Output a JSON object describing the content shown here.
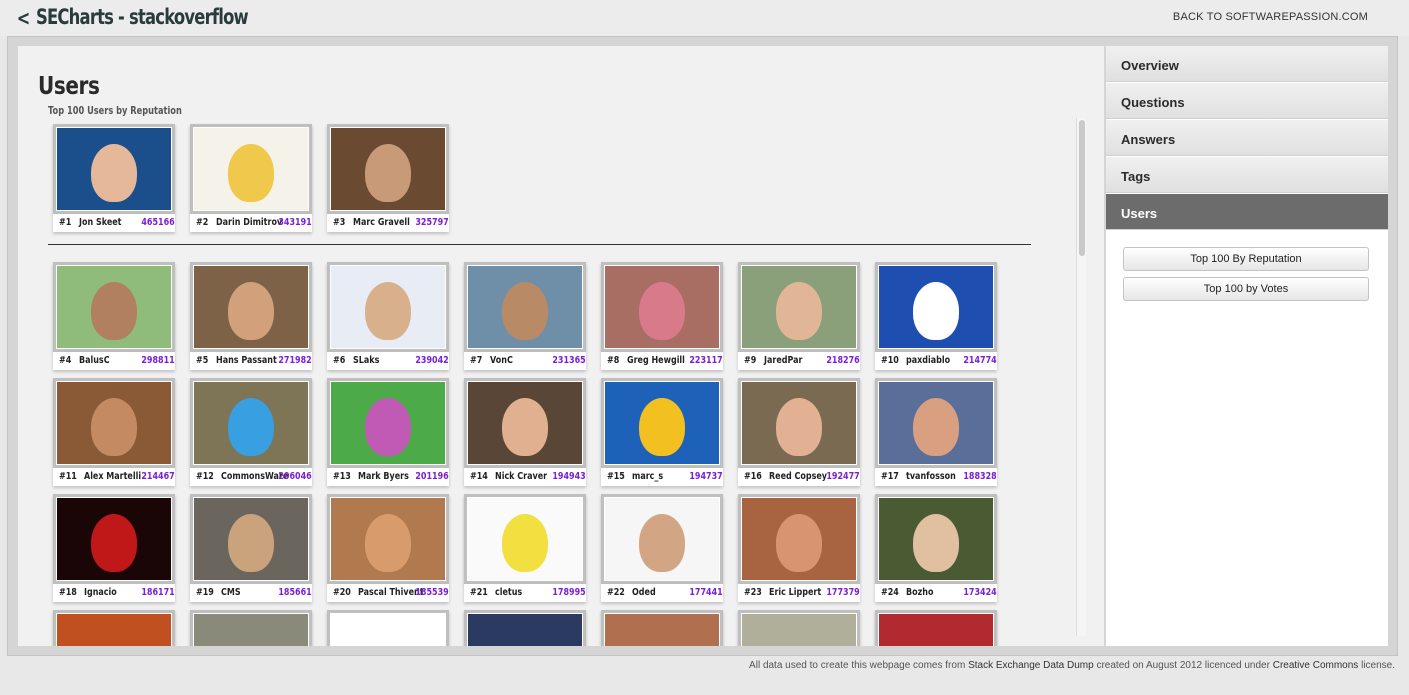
{
  "header": {
    "back_arrow": "<",
    "title": "SECharts - stackoverflow",
    "back_link": "BACK TO SOFTWAREPASSION.COM"
  },
  "main": {
    "title": "Users",
    "subtitle": "Top 100 Users by Reputation"
  },
  "top_users": [
    {
      "rank": "#1",
      "name": "Jon Skeet",
      "rep": "465166",
      "bg": "#1b4f8c",
      "face": "#e6b89a"
    },
    {
      "rank": "#2",
      "name": "Darin Dimitrov",
      "rep": "343191",
      "bg": "#f5f2ea",
      "face": "#f0c84c"
    },
    {
      "rank": "#3",
      "name": "Marc Gravell",
      "rep": "325797",
      "bg": "#6b4a32",
      "face": "#c99a78"
    }
  ],
  "users": [
    {
      "rank": "#4",
      "name": "BalusC",
      "rep": "298811",
      "bg": "#8fbc7a",
      "face": "#b08060"
    },
    {
      "rank": "#5",
      "name": "Hans Passant",
      "rep": "271982",
      "bg": "#7d6248",
      "face": "#d2a07a"
    },
    {
      "rank": "#6",
      "name": "SLaks",
      "rep": "239042",
      "bg": "#e8ecf4",
      "face": "#d8b08c"
    },
    {
      "rank": "#7",
      "name": "VonC",
      "rep": "231365",
      "bg": "#6f8fa8",
      "face": "#b88a66"
    },
    {
      "rank": "#8",
      "name": "Greg Hewgill",
      "rep": "223117",
      "bg": "#a86e64",
      "face": "#d87a8a"
    },
    {
      "rank": "#9",
      "name": "JaredPar",
      "rep": "218276",
      "bg": "#8aa07a",
      "face": "#e0b696"
    },
    {
      "rank": "#10",
      "name": "paxdiablo",
      "rep": "214774",
      "bg": "#1e4fb0",
      "face": "#ffffff"
    },
    {
      "rank": "#11",
      "name": "Alex Martelli",
      "rep": "214467",
      "bg": "#8a5a36",
      "face": "#c48a62"
    },
    {
      "rank": "#12",
      "name": "CommonsWare",
      "rep": "206046",
      "bg": "#7e7456",
      "face": "#38a0e0"
    },
    {
      "rank": "#13",
      "name": "Mark Byers",
      "rep": "201196",
      "bg": "#4caa48",
      "face": "#c05ab4"
    },
    {
      "rank": "#14",
      "name": "Nick Craver",
      "rep": "194943",
      "bg": "#5a4636",
      "face": "#e0b090"
    },
    {
      "rank": "#15",
      "name": "marc_s",
      "rep": "194737",
      "bg": "#1d62b8",
      "face": "#f2c020"
    },
    {
      "rank": "#16",
      "name": "Reed Copsey",
      "rep": "192477",
      "bg": "#7a6a52",
      "face": "#e2b092"
    },
    {
      "rank": "#17",
      "name": "tvanfosson",
      "rep": "188328",
      "bg": "#5a6e9a",
      "face": "#d8a080"
    },
    {
      "rank": "#18",
      "name": "Ignacio",
      "rep": "186171",
      "bg": "#1a0606",
      "face": "#c01818"
    },
    {
      "rank": "#19",
      "name": "CMS",
      "rep": "185661",
      "bg": "#6a665e",
      "face": "#caa27c"
    },
    {
      "rank": "#20",
      "name": "Pascal Thivent",
      "rep": "185539",
      "bg": "#b07a4e",
      "face": "#d89c6c"
    },
    {
      "rank": "#21",
      "name": "cletus",
      "rep": "178995",
      "bg": "#fafafa",
      "face": "#f2e040"
    },
    {
      "rank": "#22",
      "name": "Oded",
      "rep": "177441",
      "bg": "#f6f6f6",
      "face": "#d2a684"
    },
    {
      "rank": "#23",
      "name": "Eric Lippert",
      "rep": "177379",
      "bg": "#a86440",
      "face": "#d89470"
    },
    {
      "rank": "#24",
      "name": "Bozho",
      "rep": "173424",
      "bg": "#4a5a32",
      "face": "#e0c0a0"
    }
  ],
  "partial_row_colors": [
    "#c05020",
    "#8a8a7a",
    "#ffffff",
    "#2a3a60",
    "#b07050",
    "#b0b09a",
    "#b02a30"
  ],
  "sidebar": {
    "nav": [
      "Overview",
      "Questions",
      "Answers",
      "Tags",
      "Users"
    ],
    "active": "Users",
    "buttons": [
      "Top 100 By Reputation",
      "Top 100 by Votes"
    ]
  },
  "footer": {
    "text1": "All data used to create this webpage comes from ",
    "link1": "Stack Exchange Data Dump",
    "text2": " created on August 2012 licenced under ",
    "link2": "Creative Commons",
    "text3": " license."
  }
}
